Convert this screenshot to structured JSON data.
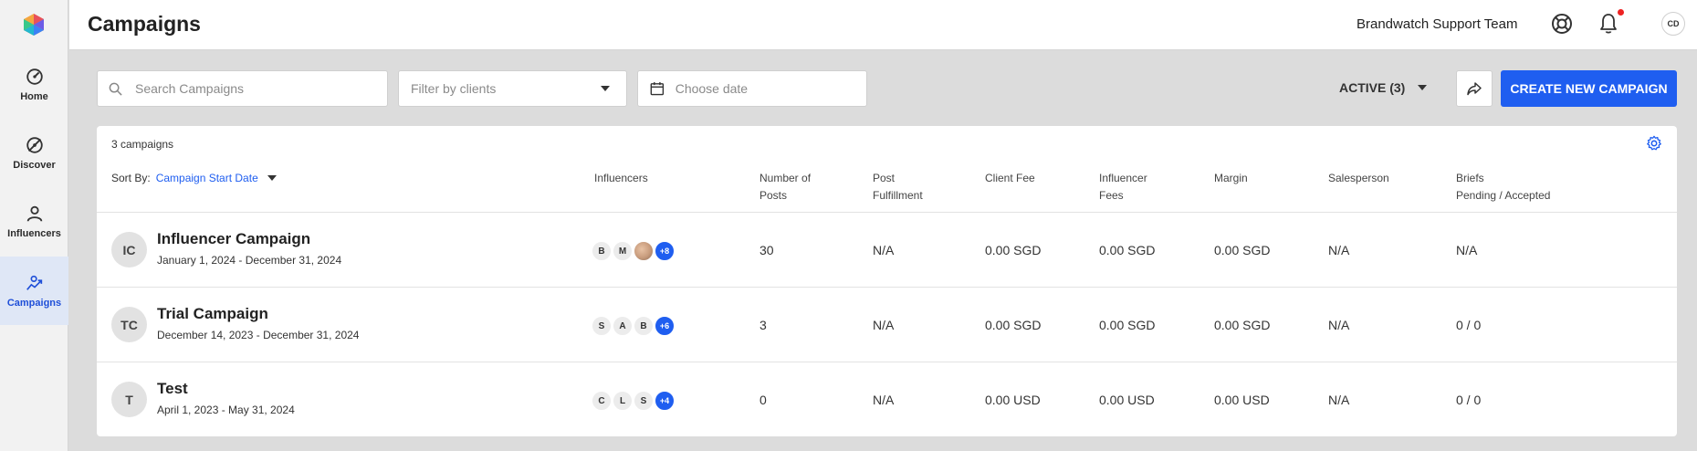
{
  "header": {
    "title": "Campaigns",
    "team_name": "Brandwatch Support Team",
    "user_initials": "CD"
  },
  "sidebar": {
    "items": [
      {
        "label": "Home",
        "icon": "home-gauge-icon"
      },
      {
        "label": "Discover",
        "icon": "discover-icon"
      },
      {
        "label": "Influencers",
        "icon": "person-icon"
      },
      {
        "label": "Campaigns",
        "icon": "campaign-chart-icon",
        "active": true
      }
    ]
  },
  "toolbar": {
    "search_placeholder": "Search Campaigns",
    "client_filter_placeholder": "Filter by clients",
    "date_placeholder": "Choose date",
    "status_label": "ACTIVE (3)",
    "create_label": "CREATE NEW CAMPAIGN"
  },
  "table": {
    "count_label": "3 campaigns",
    "sort_prefix": "Sort By:",
    "sort_value": "Campaign Start Date",
    "columns": [
      {
        "line1": "Influencers",
        "line2": ""
      },
      {
        "line1": "Number of",
        "line2": "Posts"
      },
      {
        "line1": "Post",
        "line2": "Fulfillment"
      },
      {
        "line1": "Client Fee",
        "line2": ""
      },
      {
        "line1": "Influencer",
        "line2": "Fees"
      },
      {
        "line1": "Margin",
        "line2": ""
      },
      {
        "line1": "Salesperson",
        "line2": ""
      },
      {
        "line1": "Briefs",
        "line2": "Pending / Accepted"
      }
    ],
    "rows": [
      {
        "initials": "IC",
        "name": "Influencer Campaign",
        "dates": "January 1, 2024 - December 31, 2024",
        "influencers": [
          "B",
          "M",
          "photo"
        ],
        "more": "+8",
        "posts": "30",
        "fulfillment": "N/A",
        "client_fee": "0.00 SGD",
        "influencer_fees": "0.00 SGD",
        "margin": "0.00 SGD",
        "salesperson": "N/A",
        "briefs": "N/A"
      },
      {
        "initials": "TC",
        "name": "Trial Campaign",
        "dates": "December 14, 2023 - December 31, 2024",
        "influencers": [
          "S",
          "A",
          "B"
        ],
        "more": "+6",
        "posts": "3",
        "fulfillment": "N/A",
        "client_fee": "0.00 SGD",
        "influencer_fees": "0.00 SGD",
        "margin": "0.00 SGD",
        "salesperson": "N/A",
        "briefs": "0 / 0"
      },
      {
        "initials": "T",
        "name": "Test",
        "dates": "April 1, 2023 - May 31, 2024",
        "influencers": [
          "C",
          "L",
          "S"
        ],
        "more": "+4",
        "posts": "0",
        "fulfillment": "N/A",
        "client_fee": "0.00 USD",
        "influencer_fees": "0.00 USD",
        "margin": "0.00 USD",
        "salesperson": "N/A",
        "briefs": "0 / 0"
      }
    ]
  },
  "colors": {
    "accent": "#1f5ef0",
    "active_nav_bg": "#dfe7f6",
    "notification_dot": "#ee2222"
  }
}
